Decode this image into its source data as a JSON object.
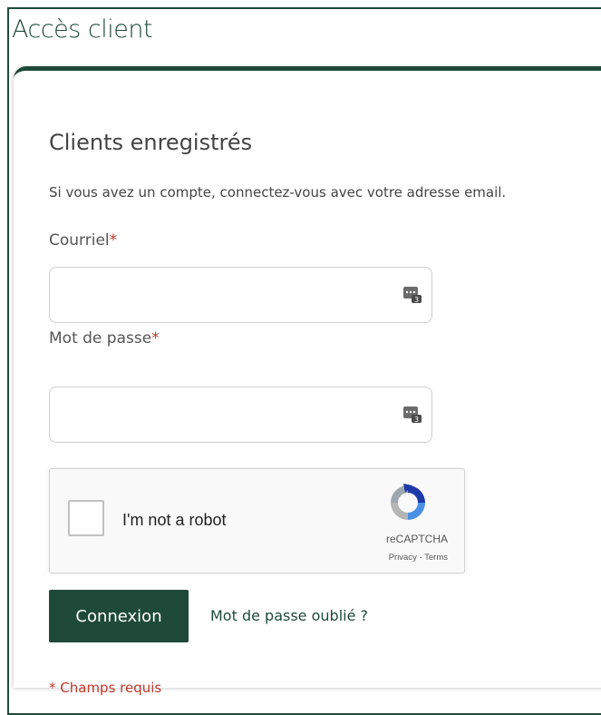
{
  "page": {
    "title": "Accès client"
  },
  "login": {
    "heading": "Clients enregistrés",
    "intro": "Si vous avez un compte, connectez-vous avec votre adresse email.",
    "email_label": "Courriel",
    "email_value": "",
    "password_label": "Mot de passe",
    "password_value": "",
    "required_mark": "*",
    "submit_label": "Connexion",
    "forgot_label": "Mot de passe oublié ?",
    "required_note": "* Champs requis"
  },
  "recaptcha": {
    "checkbox_label": "I'm not a robot",
    "brand": "reCAPTCHA",
    "privacy": "Privacy",
    "separator": " - ",
    "terms": "Terms"
  },
  "icons": {
    "password_manager": "password-manager-icon",
    "recaptcha_logo": "recaptcha-logo-icon"
  },
  "colors": {
    "brand": "#1f4a3a",
    "required": "#c0392b"
  }
}
